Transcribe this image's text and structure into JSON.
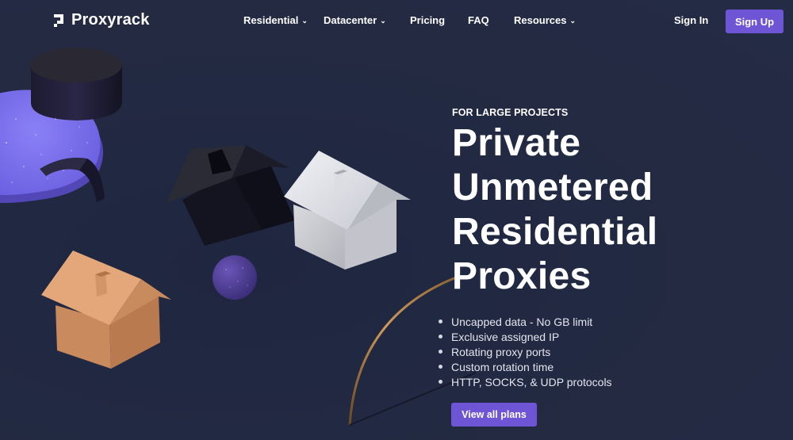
{
  "brand": {
    "name": "Proxyrack",
    "accent": "#6d55d5",
    "background": "#232a42"
  },
  "nav": {
    "items": [
      {
        "label": "Residential",
        "has_dropdown": true,
        "icon": "chevron-down-icon"
      },
      {
        "label": "Datacenter",
        "has_dropdown": true,
        "icon": "chevron-down-icon"
      },
      {
        "label": "Pricing",
        "has_dropdown": false
      },
      {
        "label": "FAQ",
        "has_dropdown": false
      },
      {
        "label": "Resources",
        "has_dropdown": true,
        "icon": "chevron-down-icon"
      }
    ],
    "sign_in": "Sign In",
    "sign_up": "Sign Up",
    "chevron": "⌄"
  },
  "hero": {
    "eyebrow": "FOR LARGE PROJECTS",
    "title_lines": [
      "Private",
      "Unmetered",
      "Residential",
      "Proxies"
    ],
    "features": [
      "Uncapped data - No GB limit",
      "Exclusive assigned IP",
      "Rotating proxy ports",
      "Custom rotation time",
      "HTTP, SOCKS, & UDP protocols"
    ],
    "cta": "View all plans"
  },
  "illustration": {
    "objects": [
      "dark-cylinder",
      "purple-disc",
      "ribbon",
      "black-house",
      "marble-house",
      "purple-sphere",
      "orange-house",
      "gold-arc"
    ]
  }
}
